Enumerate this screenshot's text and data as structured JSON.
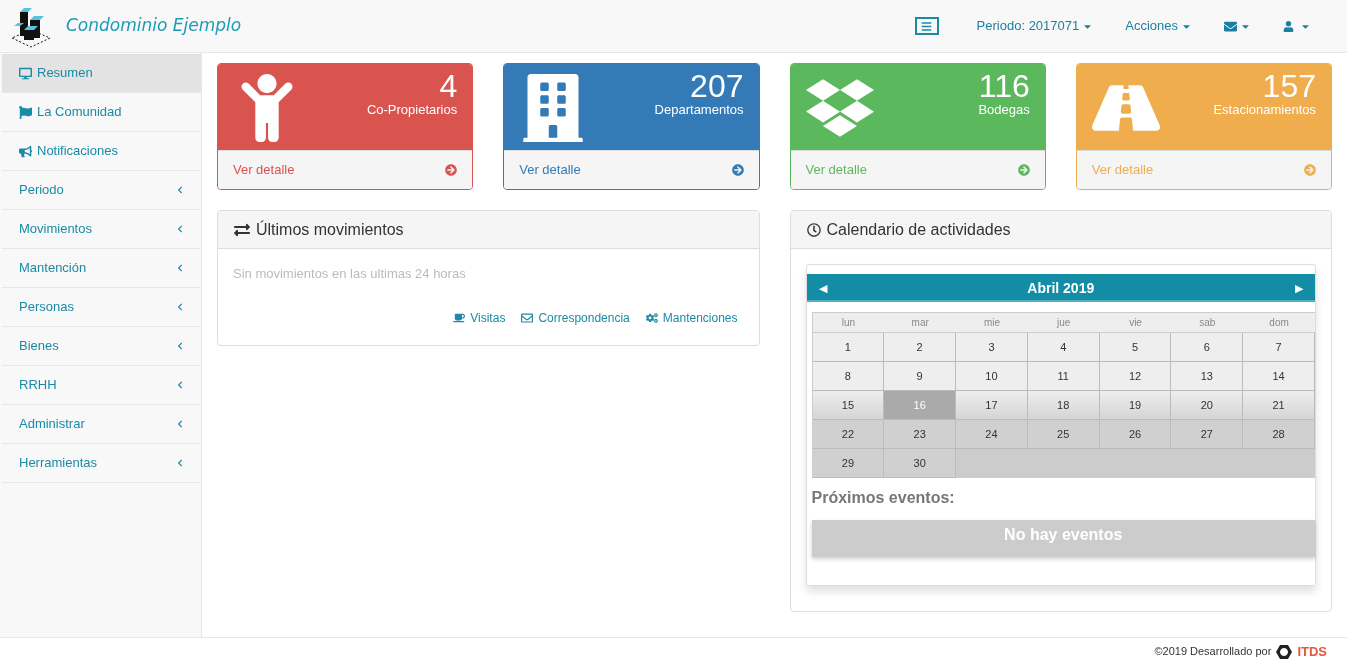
{
  "header": {
    "title": "Condominio Ejemplo",
    "menu": [
      {
        "kind": "text",
        "label": "Periodo: 2017071"
      },
      {
        "kind": "text",
        "label": "Acciones"
      },
      {
        "kind": "mail"
      },
      {
        "kind": "user"
      }
    ]
  },
  "sidebar": {
    "items": [
      {
        "kind": "monitor",
        "label": "Resumen",
        "selected": true
      },
      {
        "kind": "flag",
        "label": "La Comunidad",
        "selected": false
      },
      {
        "kind": "bullhorn",
        "label": "Notificaciones",
        "selected": false
      },
      {
        "kind": "group",
        "label": "Periodo",
        "selected": false
      },
      {
        "kind": "group",
        "label": "Movimientos",
        "selected": false
      },
      {
        "kind": "group",
        "label": "Mantención",
        "selected": false
      },
      {
        "kind": "group",
        "label": "Personas",
        "selected": false
      },
      {
        "kind": "group",
        "label": "Bienes",
        "selected": false
      },
      {
        "kind": "group",
        "label": "RRHH",
        "selected": false
      },
      {
        "kind": "group",
        "label": "Administrar",
        "selected": false
      },
      {
        "kind": "group",
        "label": "Herramientas",
        "selected": false
      }
    ]
  },
  "stats": [
    {
      "kind": "person",
      "count": "4",
      "label": "Co-Propietarios",
      "link": "Ver detalle",
      "color": "#d9534f"
    },
    {
      "kind": "building",
      "count": "207",
      "label": "Departamentos",
      "link": "Ver detalle",
      "color": "#337ab7"
    },
    {
      "kind": "boxes",
      "count": "116",
      "label": "Bodegas",
      "link": "Ver detalle",
      "color": "#5cb85c"
    },
    {
      "kind": "road",
      "count": "157",
      "label": "Estacionamientos",
      "link": "Ver detalle",
      "color": "#f0ad4e"
    }
  ],
  "movements": {
    "title": "Últimos movimientos",
    "message": "Sin movimientos en las ultimas 24 horas",
    "links": [
      {
        "kind": "coffee",
        "label": "Visitas"
      },
      {
        "kind": "envelope",
        "label": "Correspondencia"
      },
      {
        "kind": "gears",
        "label": "Mantenciones"
      }
    ]
  },
  "calendar": {
    "title": "Calendario de actividades",
    "month": "Abril 2019",
    "prev": "◀",
    "next": "▶",
    "weekdays": [
      "lun",
      "mar",
      "mie",
      "jue",
      "vie",
      "sab",
      "dom"
    ],
    "weeks": [
      [
        {
          "day": "1",
          "selected": false
        },
        {
          "day": "2",
          "selected": false
        },
        {
          "day": "3",
          "selected": false
        },
        {
          "day": "4",
          "selected": false
        },
        {
          "day": "5",
          "selected": false
        },
        {
          "day": "6",
          "selected": false
        },
        {
          "day": "7",
          "selected": false
        }
      ],
      [
        {
          "day": "8",
          "selected": false
        },
        {
          "day": "9",
          "selected": false
        },
        {
          "day": "10",
          "selected": false
        },
        {
          "day": "11",
          "selected": false
        },
        {
          "day": "12",
          "selected": false
        },
        {
          "day": "13",
          "selected": false
        },
        {
          "day": "14",
          "selected": false
        }
      ],
      [
        {
          "day": "15",
          "selected": false
        },
        {
          "day": "16",
          "selected": true
        },
        {
          "day": "17",
          "selected": false
        },
        {
          "day": "18",
          "selected": false
        },
        {
          "day": "19",
          "selected": false
        },
        {
          "day": "20",
          "selected": false
        },
        {
          "day": "21",
          "selected": false
        }
      ],
      [
        {
          "day": "22",
          "selected": false
        },
        {
          "day": "23",
          "selected": false
        },
        {
          "day": "24",
          "selected": false
        },
        {
          "day": "25",
          "selected": false
        },
        {
          "day": "26",
          "selected": false
        },
        {
          "day": "27",
          "selected": false
        },
        {
          "day": "28",
          "selected": false
        }
      ],
      [
        {
          "day": "29",
          "selected": false
        },
        {
          "day": "30",
          "selected": false
        }
      ]
    ],
    "events_title": "Próximos eventos:",
    "events_empty": "No hay eventos"
  },
  "footer": {
    "text": "©2019 Desarrollado por",
    "logo": "ITDS"
  }
}
